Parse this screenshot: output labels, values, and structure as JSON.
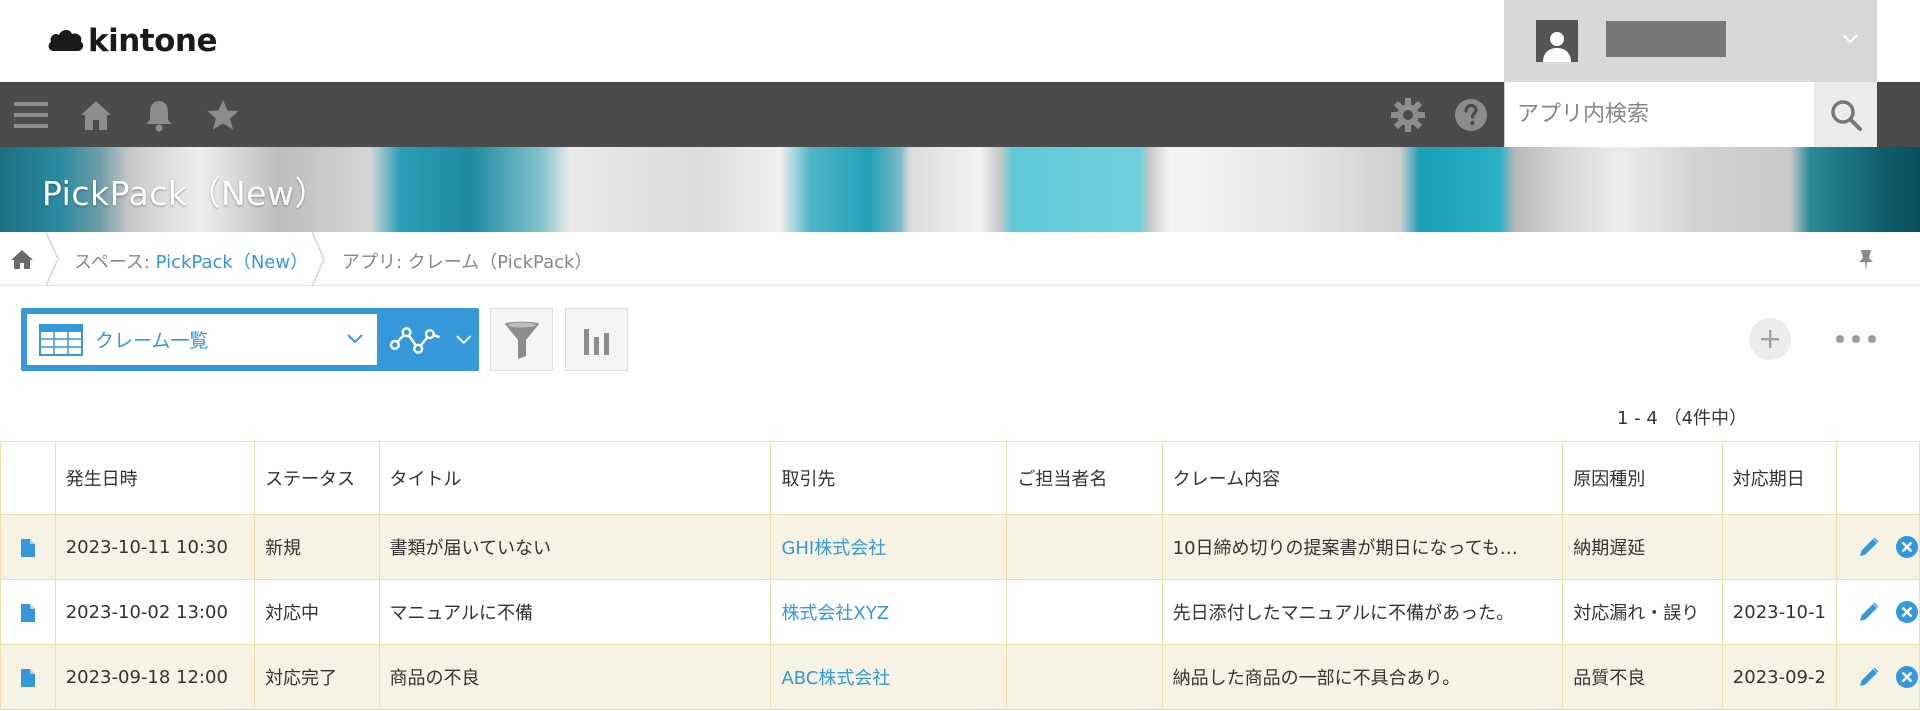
{
  "header": {
    "logo_text": "kintone",
    "user_name": ""
  },
  "navbar": {
    "icons": [
      "menu-icon",
      "home-icon",
      "bell-icon",
      "star-icon",
      "gear-icon",
      "help-icon"
    ],
    "search_placeholder": "アプリ内検索"
  },
  "banner": {
    "title": "PickPack（New）"
  },
  "breadcrumb": {
    "space_prefix": "スペース: ",
    "space_name": "PickPack（New）",
    "app_label": "アプリ: クレーム（PickPack）"
  },
  "toolbar": {
    "view_name": "クレーム一覧",
    "pager": "1 - 4 （4件中）"
  },
  "colors": {
    "accent": "#3498db",
    "navbar": "#4b4b4b",
    "row_alt": "#f7f3e4",
    "border": "#f0ddb0"
  },
  "table": {
    "columns": [
      "",
      "発生日時",
      "ステータス",
      "タイトル",
      "取引先",
      "ご担当者名",
      "クレーム内容",
      "原因種別",
      "対応期日",
      ""
    ],
    "rows": [
      {
        "date": "2023-10-11 10:30",
        "status": "新規",
        "title": "書類が届いていない",
        "client": "GHI株式会社",
        "contact": "",
        "content": "10日締め切りの提案書が期日になっても…",
        "cause": "納期遅延",
        "due": ""
      },
      {
        "date": "2023-10-02 13:00",
        "status": "対応中",
        "title": "マニュアルに不備",
        "client": "株式会社XYZ",
        "contact": "",
        "content": "先日添付したマニュアルに不備があった。",
        "cause": "対応漏れ・誤り",
        "due": "2023-10-1"
      },
      {
        "date": "2023-09-18 12:00",
        "status": "対応完了",
        "title": "商品の不良",
        "client": "ABC株式会社",
        "contact": "",
        "content": "納品した商品の一部に不具合あり。",
        "cause": "品質不良",
        "due": "2023-09-2"
      }
    ]
  }
}
